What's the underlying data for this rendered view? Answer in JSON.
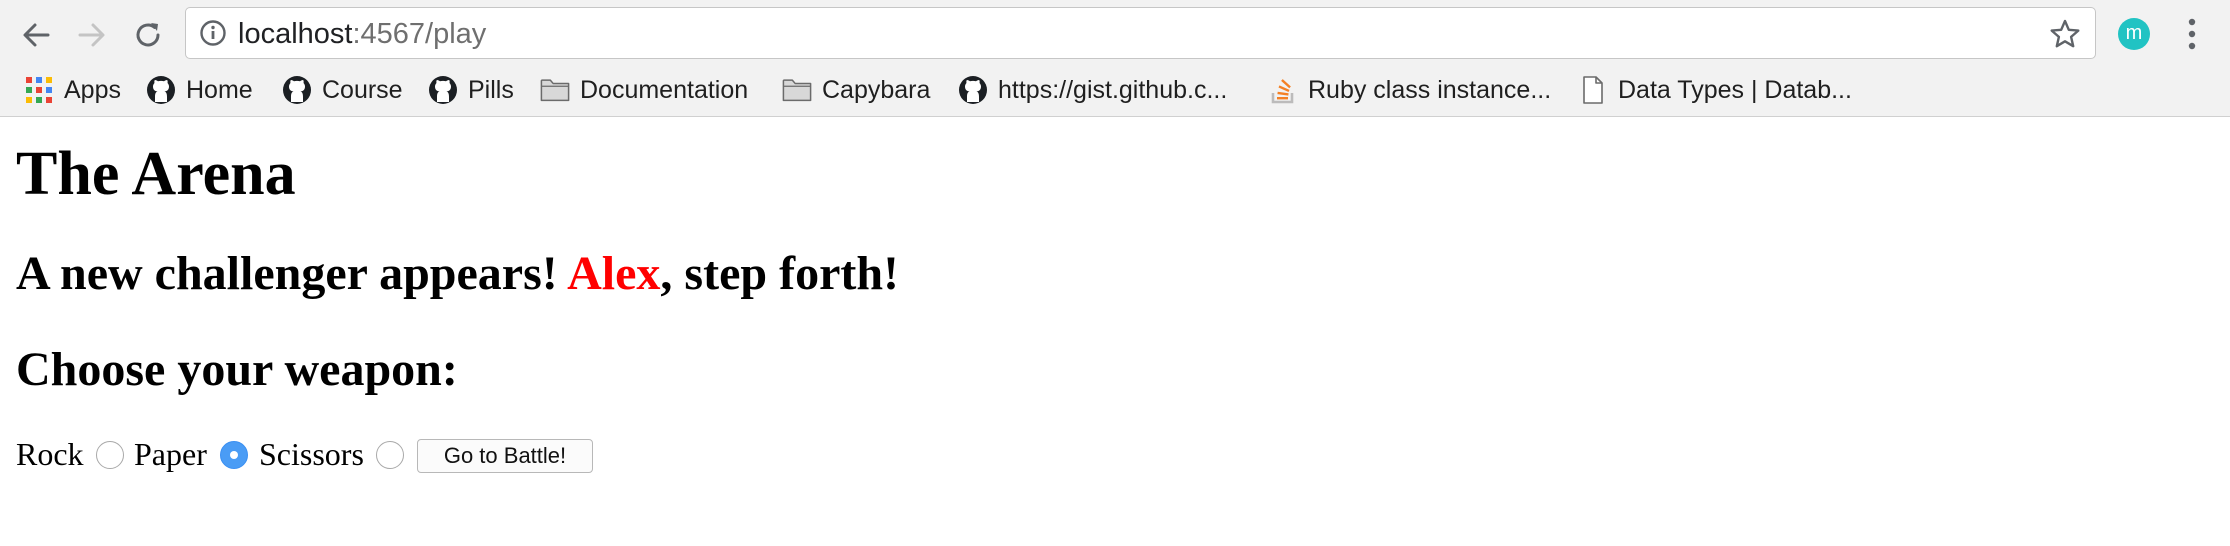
{
  "browser": {
    "url_host": "localhost",
    "url_rest": ":4567/play",
    "profile_initial": "m",
    "bookmarks": [
      {
        "label": "Apps",
        "icon": "apps-grid-icon"
      },
      {
        "label": "Home",
        "icon": "github-icon"
      },
      {
        "label": "Course",
        "icon": "github-icon"
      },
      {
        "label": "Pills",
        "icon": "github-icon"
      },
      {
        "label": "Documentation",
        "icon": "folder-icon"
      },
      {
        "label": "Capybara",
        "icon": "folder-icon"
      },
      {
        "label": "https://gist.github.c...",
        "icon": "github-icon"
      },
      {
        "label": "Ruby class instance...",
        "icon": "stackoverflow-icon"
      },
      {
        "label": "Data Types | Datab...",
        "icon": "page-icon"
      }
    ]
  },
  "page": {
    "title": "The Arena",
    "challenger_prefix": "A new challenger appears! ",
    "challenger_name": "Alex",
    "challenger_suffix": ", step forth!",
    "choose_heading": "Choose your weapon:",
    "weapons": [
      {
        "label": "Rock",
        "selected": false
      },
      {
        "label": "Paper",
        "selected": true
      },
      {
        "label": "Scissors",
        "selected": false
      }
    ],
    "submit_label": "Go to Battle!"
  },
  "colors": {
    "challenger_name": "#ff0000",
    "radio_selected": "#4a9cf5",
    "profile_avatar": "#21c3c3"
  }
}
